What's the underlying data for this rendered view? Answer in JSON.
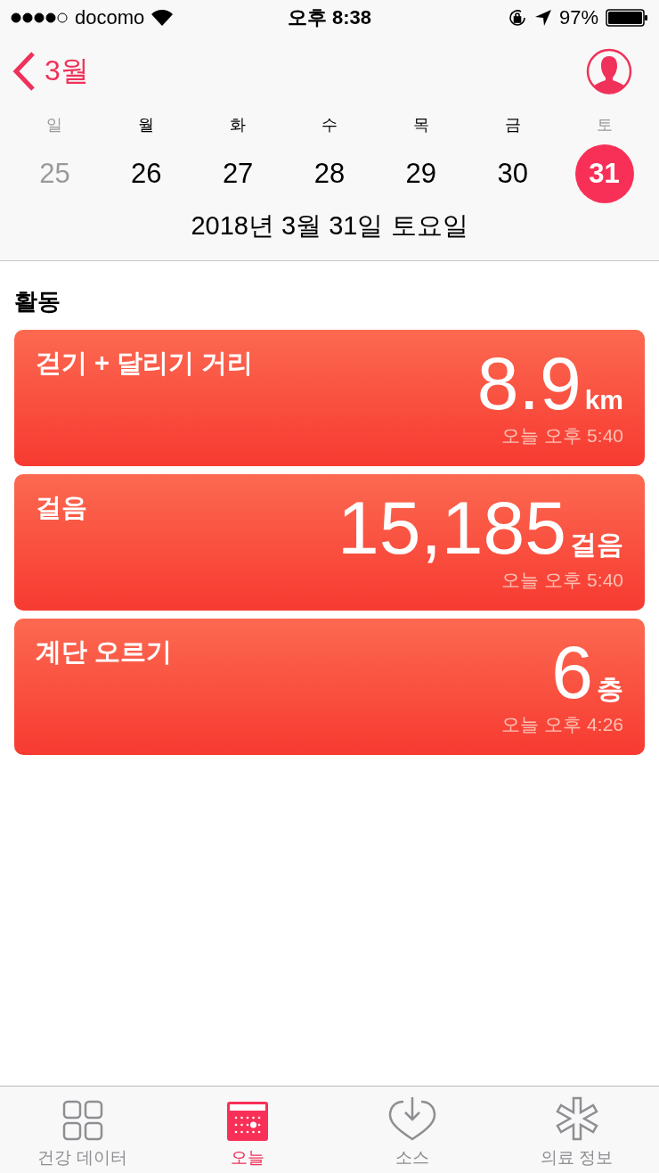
{
  "status_bar": {
    "carrier": "docomo",
    "time": "오후 8:38",
    "battery": "97%"
  },
  "nav": {
    "back_label": "3월"
  },
  "week": [
    {
      "weekday": "일",
      "date": "25",
      "weekend": true,
      "selected": false
    },
    {
      "weekday": "월",
      "date": "26",
      "weekend": false,
      "selected": false
    },
    {
      "weekday": "화",
      "date": "27",
      "weekend": false,
      "selected": false
    },
    {
      "weekday": "수",
      "date": "28",
      "weekend": false,
      "selected": false
    },
    {
      "weekday": "목",
      "date": "29",
      "weekend": false,
      "selected": false
    },
    {
      "weekday": "금",
      "date": "30",
      "weekend": false,
      "selected": false
    },
    {
      "weekday": "토",
      "date": "31",
      "weekend": true,
      "selected": true
    }
  ],
  "selected_date": "2018년 3월 31일 토요일",
  "section": {
    "title": "활동",
    "cards": [
      {
        "title": "걷기 + 달리기 거리",
        "value": "8.9",
        "unit": "km",
        "time": "오늘 오후 5:40"
      },
      {
        "title": "걸음",
        "value": "15,185",
        "unit": "걸음",
        "time": "오늘 오후 5:40"
      },
      {
        "title": "계단 오르기",
        "value": "6",
        "unit": "층",
        "time": "오늘 오후 4:26"
      }
    ]
  },
  "tab_bar": [
    {
      "kind": "grid",
      "label": "건강 데이터",
      "selected": false
    },
    {
      "kind": "calendar",
      "label": "오늘",
      "selected": true
    },
    {
      "kind": "heart",
      "label": "소스",
      "selected": false
    },
    {
      "kind": "asterisk",
      "label": "의료 정보",
      "selected": false
    }
  ]
}
